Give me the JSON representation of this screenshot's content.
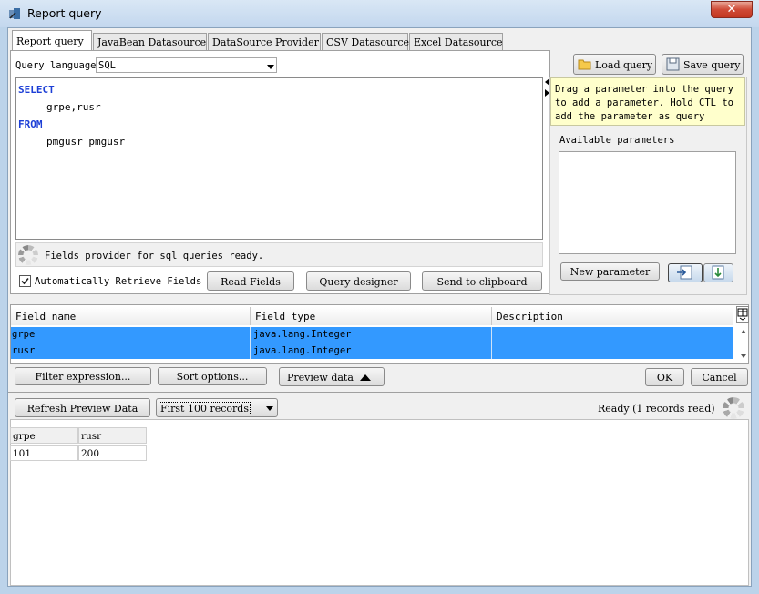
{
  "window": {
    "title": "Report query"
  },
  "tabs": [
    "Report query",
    "JavaBean Datasource",
    "DataSource Provider",
    "CSV Datasource",
    "Excel Datasource"
  ],
  "query_language": {
    "label": "Query language",
    "value": "SQL"
  },
  "buttons": {
    "load_query": "Load query",
    "save_query": "Save query",
    "read_fields": "Read Fields",
    "query_designer": "Query designer",
    "send_to_clipboard": "Send to clipboard",
    "new_parameter": "New parameter",
    "filter_expression": "Filter expression...",
    "sort_options": "Sort options...",
    "preview_data": "Preview data",
    "ok": "OK",
    "cancel": "Cancel",
    "refresh_preview": "Refresh Preview Data"
  },
  "sql": {
    "line1": "SELECT",
    "line2": "grpe,rusr",
    "line3": "FROM",
    "line4": "pmgusr pmgusr"
  },
  "status_text": "Fields provider for sql queries ready.",
  "auto_retrieve_label": "Automatically Retrieve Fields",
  "hint": "Drag a parameter into the query to add a parameter. Hold CTL to add the parameter as query chunk.",
  "available_parameters_label": "Available parameters",
  "fields_table": {
    "headers": [
      "Field name",
      "Field type",
      "Description"
    ],
    "rows": [
      {
        "name": "grpe",
        "type": "java.lang.Integer",
        "description": ""
      },
      {
        "name": "rusr",
        "type": "java.lang.Integer",
        "description": ""
      }
    ]
  },
  "records_select": {
    "value": "First 100 records"
  },
  "ready_status": "Ready (1 records read)",
  "preview_table": {
    "headers": [
      "grpe",
      "rusr"
    ],
    "rows": [
      [
        "101",
        "200"
      ]
    ]
  }
}
